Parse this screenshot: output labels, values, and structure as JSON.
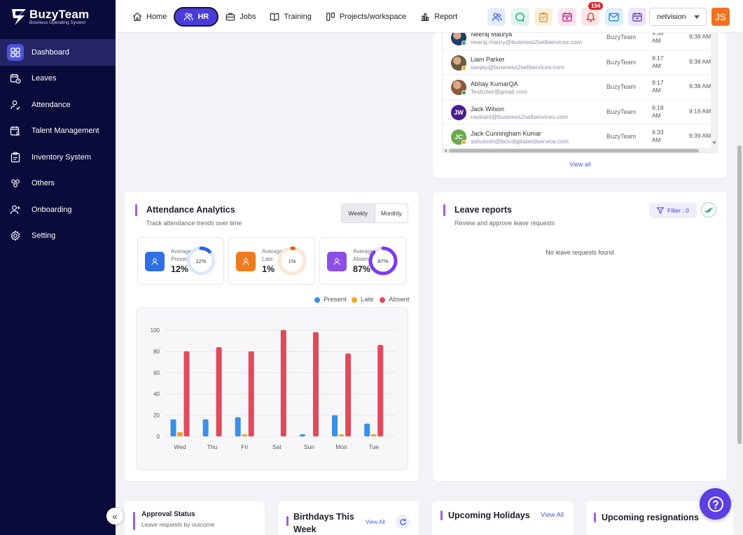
{
  "brand": {
    "name": "BuzyTeam",
    "tagline": "Business Operating System"
  },
  "sidebar": {
    "items": [
      {
        "label": "Dashboard",
        "icon": "dashboard-icon",
        "active": true
      },
      {
        "label": "Leaves",
        "icon": "calendar-clock-icon"
      },
      {
        "label": "Attendance",
        "icon": "user-check-icon"
      },
      {
        "label": "Talent Management",
        "icon": "calendar-user-icon"
      },
      {
        "label": "Inventory System",
        "icon": "clipboard-icon"
      },
      {
        "label": "Others",
        "icon": "group-icon"
      },
      {
        "label": "Onboarding",
        "icon": "user-plus-icon"
      },
      {
        "label": "Setting",
        "icon": "gear-icon"
      }
    ],
    "collapse_glyph": "«"
  },
  "topnav": {
    "items": [
      {
        "label": "Home",
        "icon": "home-icon"
      },
      {
        "label": "HR",
        "icon": "users-icon",
        "active": true
      },
      {
        "label": "Jobs",
        "icon": "briefcase-icon"
      },
      {
        "label": "Training",
        "icon": "book-icon"
      },
      {
        "label": "Projects/workspace",
        "icon": "kanban-icon"
      },
      {
        "label": "Report",
        "icon": "bar-chart-icon"
      }
    ],
    "notification_count": "194",
    "workspace": "netvision",
    "user_initials": "JS",
    "colors": {
      "accent": "#4a3bd8",
      "avatar": "#f0731f"
    }
  },
  "attendance_table": {
    "rows": [
      {
        "name": "Neeraj Maurya",
        "email": "neeraj.maury@business2sellservices.com",
        "org": "BuzyTeam",
        "in_time": "9:38 AM",
        "out_time": "9:38 AM",
        "avatar": "photo",
        "avatar_color": "#1f3d6b",
        "status_color": "#2ea44f"
      },
      {
        "name": "Liam Parker",
        "email": "sanjay@business2sellservices.com",
        "org": "BuzyTeam",
        "in_time": "9:17 AM",
        "out_time": "9:38 AM",
        "avatar": "photo",
        "avatar_color": "#6b5a3a",
        "status_color": "#f5a524"
      },
      {
        "name": "Abhay KumarQA",
        "email": "TestUser@gmail.com",
        "org": "BuzyTeam",
        "in_time": "9:17 AM",
        "out_time": "9:38 AM",
        "avatar": "photo",
        "avatar_color": "#8a5a3a",
        "status_color": "#2ea44f"
      },
      {
        "name": "Jack Wilson",
        "email": "ravikant@business2sellservices.com",
        "org": "BuzyTeam",
        "in_time": "9:18 AM",
        "out_time": "9:18 AM",
        "avatar": "JW",
        "avatar_color": "#4b1d8f",
        "status_color": ""
      },
      {
        "name": "Jack Cunningham Kumar",
        "email": "ashutosh@bcicdigitalandservice.com",
        "org": "BuzyTeam",
        "in_time": "9:33 AM",
        "out_time": "9:39 AM",
        "avatar": "JC",
        "avatar_color": "#6aa84f",
        "status_color": "#f5a524"
      }
    ],
    "view_all": "View all"
  },
  "attendance_analytics": {
    "title": "Attendance Analytics",
    "subtitle": "Track attendance trends over time",
    "toggle": [
      "Weekly",
      "Monthly"
    ],
    "stats": [
      {
        "label": "Average Present",
        "value": "12%",
        "percent": 12,
        "ring_label": "12%",
        "color": "#2563eb",
        "track": "#dbe7fb",
        "icon_bg": "#2f6fe4"
      },
      {
        "label": "Average Late",
        "value": "1%",
        "percent": 1,
        "ring_label": "1%",
        "color": "#e35d0f",
        "track": "#fbe7d6",
        "icon_bg": "#f07a1e"
      },
      {
        "label": "Average Absent",
        "value": "87%",
        "percent": 87,
        "ring_label": "87%",
        "color": "#7c3aed",
        "track": "#ece4fb",
        "icon_bg": "#8b4fe6"
      }
    ]
  },
  "chart_data": {
    "type": "bar",
    "categories": [
      "Wed",
      "Thu",
      "Fri",
      "Sat",
      "Sun",
      "Mon",
      "Tue"
    ],
    "series": [
      {
        "name": "Present",
        "color": "#3a8fe8",
        "values": [
          16,
          16,
          18,
          0,
          2,
          20,
          12
        ]
      },
      {
        "name": "Late",
        "color": "#f5a524",
        "values": [
          4,
          0,
          2,
          0,
          0,
          2,
          2
        ]
      },
      {
        "name": "Absent",
        "color": "#e04a5a",
        "values": [
          80,
          84,
          80,
          100,
          98,
          78,
          86
        ]
      }
    ],
    "y_ticks": [
      "0",
      "20",
      "40",
      "60",
      "80",
      "100"
    ],
    "ylim": [
      0,
      100
    ],
    "grid": true,
    "legend": "top-right"
  },
  "leave_reports": {
    "title": "Leave reports",
    "subtitle": "Review and approve leave requests",
    "filter_label": "Filter : 0",
    "empty": "No leave requests found"
  },
  "bottom_cards": {
    "approval": {
      "title": "Approval Status",
      "subtitle": "Leave requests by outcome"
    },
    "birthdays": {
      "title_line1": "Birthdays This",
      "title_line2": "Week",
      "view_all": "View All"
    },
    "holidays": {
      "title": "Upcoming Holidays",
      "view_all": "View All"
    },
    "resignations": {
      "title": "Upcoming resignations"
    }
  }
}
